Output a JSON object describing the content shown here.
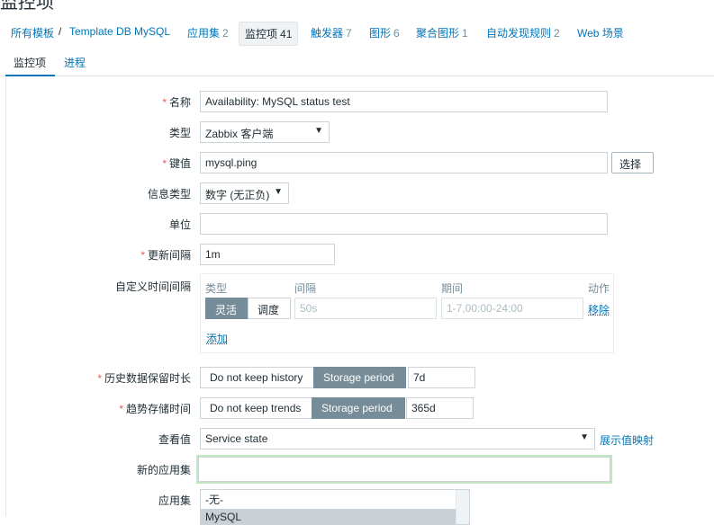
{
  "page": {
    "title": "监控项"
  },
  "breadcrumb": {
    "all_templates": "所有模板",
    "separator": "/",
    "template": "Template DB MySQL",
    "applications": {
      "label": "应用集",
      "count": "2"
    },
    "items": {
      "label": "监控项",
      "count": "41"
    },
    "triggers": {
      "label": "触发器",
      "count": "7"
    },
    "graphs": {
      "label": "图形",
      "count": "6"
    },
    "screens": {
      "label": "聚合图形",
      "count": "1"
    },
    "discovery": {
      "label": "自动发现规则",
      "count": "2"
    },
    "web": {
      "label": "Web 场景"
    }
  },
  "tabs": {
    "item": "监控项",
    "preprocessing": "进程"
  },
  "form": {
    "required_mark": "*",
    "name": {
      "label": "名称",
      "value": "Availability: MySQL status test"
    },
    "type": {
      "label": "类型",
      "value": "Zabbix 客户端"
    },
    "key": {
      "label": "键值",
      "value": "mysql.ping",
      "select_button": "选择"
    },
    "info_type": {
      "label": "信息类型",
      "value": "数字 (无正负)"
    },
    "units": {
      "label": "单位",
      "value": ""
    },
    "update_interval": {
      "label": "更新间隔",
      "value": "1m"
    },
    "custom_intervals": {
      "label": "自定义时间间隔",
      "col_type": "类型",
      "col_interval": "间隔",
      "col_period": "期间",
      "col_action": "动作",
      "flexible": "灵活",
      "scheduling": "调度",
      "interval_placeholder": "50s",
      "period_placeholder": "1-7,00:00-24:00",
      "remove": "移除",
      "add": "添加"
    },
    "history": {
      "label": "历史数据保留时长",
      "no_keep": "Do not keep history",
      "storage": "Storage period",
      "value": "7d"
    },
    "trends": {
      "label": "趋势存储时间",
      "no_keep": "Do not keep trends",
      "storage": "Storage period",
      "value": "365d"
    },
    "show_value": {
      "label": "查看值",
      "value": "Service state",
      "mapping_link": "展示值映射"
    },
    "new_application": {
      "label": "新的应用集",
      "value": ""
    },
    "applications": {
      "label": "应用集",
      "options": [
        "-无-",
        "MySQL"
      ]
    }
  },
  "icons": {
    "dropdown": "▼"
  }
}
